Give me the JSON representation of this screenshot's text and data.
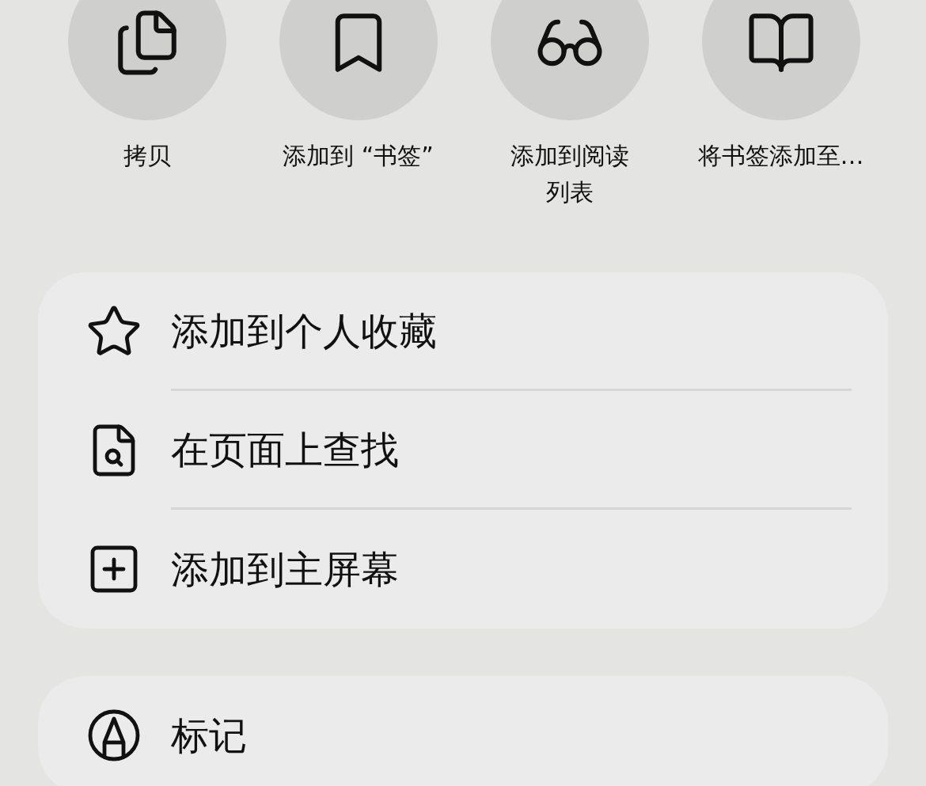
{
  "actions": [
    {
      "kind": "copy",
      "label_lines": [
        "拷贝"
      ]
    },
    {
      "kind": "bookmark",
      "label_lines": [
        "添加到 “书签”"
      ]
    },
    {
      "kind": "glasses",
      "label_lines": [
        "添加到阅读",
        "列表"
      ]
    },
    {
      "kind": "book",
      "label_lines": [
        "将书签添加至…"
      ]
    }
  ],
  "menu_groups": [
    {
      "items": [
        {
          "kind": "star",
          "label": "添加到个人收藏"
        },
        {
          "kind": "find",
          "label": "在页面上查找"
        },
        {
          "kind": "add-square",
          "label": "添加到主屏幕"
        }
      ]
    },
    {
      "items": [
        {
          "kind": "markup",
          "label": "标记"
        }
      ]
    }
  ]
}
